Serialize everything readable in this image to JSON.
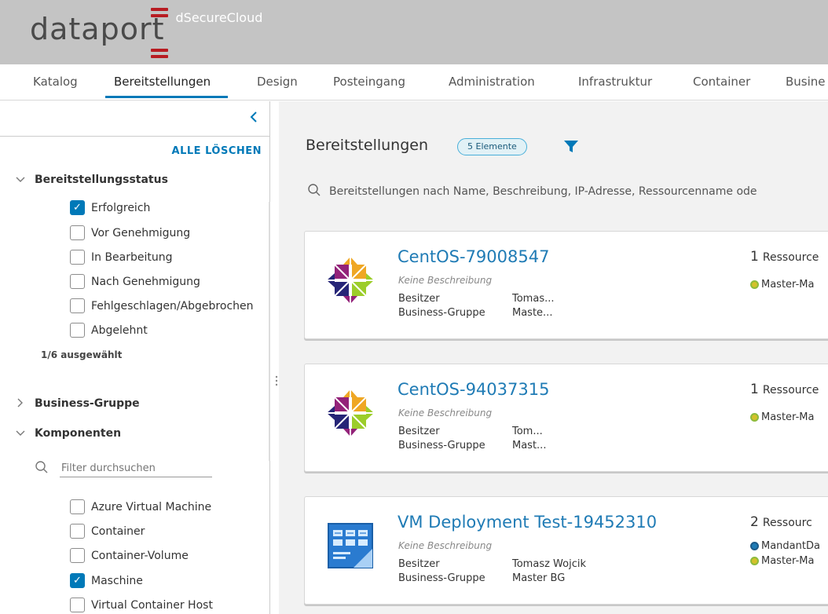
{
  "header": {
    "logo_text": "dataport",
    "product": "dSecureCloud"
  },
  "nav": {
    "items": [
      "Katalog",
      "Bereitstellungen",
      "Design",
      "Posteingang",
      "Administration",
      "Infrastruktur",
      "Container",
      "Busine"
    ],
    "active": "Bereitstellungen"
  },
  "sidebar": {
    "clear_all": "ALLE LÖSCHEN",
    "status_section": {
      "title": "Bereitstellungsstatus",
      "options": [
        {
          "label": "Erfolgreich",
          "checked": true
        },
        {
          "label": "Vor Genehmigung",
          "checked": false
        },
        {
          "label": "In Bearbeitung",
          "checked": false
        },
        {
          "label": "Nach Genehmigung",
          "checked": false
        },
        {
          "label": "Fehlgeschlagen/Abgebrochen",
          "checked": false
        },
        {
          "label": "Abgelehnt",
          "checked": false
        }
      ],
      "selected_count": "1/6 ausgewählt"
    },
    "business_group_section": {
      "title": "Business-Gruppe"
    },
    "components_section": {
      "title": "Komponenten",
      "search_placeholder": "Filter durchsuchen",
      "options": [
        {
          "label": "Azure Virtual Machine",
          "checked": false
        },
        {
          "label": "Container",
          "checked": false
        },
        {
          "label": "Container-Volume",
          "checked": false
        },
        {
          "label": "Maschine",
          "checked": true
        },
        {
          "label": "Virtual Container Host",
          "checked": false
        }
      ]
    }
  },
  "main": {
    "title": "Bereitstellungen",
    "count_badge": "5 Elemente",
    "search_placeholder": "Bereitstellungen nach Name, Beschreibung, IP-Adresse, Ressourcenname ode",
    "cards": [
      {
        "title": "CentOS-79008547",
        "description": "Keine Beschreibung",
        "owner_label": "Besitzer",
        "owner": "Tomas...",
        "group_label": "Business-Gruppe",
        "group": "Maste...",
        "resource_count": "1",
        "resource_word": "Ressource",
        "tags": [
          "Master-Ma"
        ],
        "icon": "centos-logo-icon"
      },
      {
        "title": "CentOS-94037315",
        "description": "Keine Beschreibung",
        "owner_label": "Besitzer",
        "owner": "Tom...",
        "group_label": "Business-Gruppe",
        "group": "Mast...",
        "resource_count": "1",
        "resource_word": "Ressource",
        "tags": [
          "Master-Ma"
        ],
        "icon": "centos-logo-icon"
      },
      {
        "title": "VM Deployment Test-19452310",
        "description": "Keine Beschreibung",
        "owner_label": "Besitzer",
        "owner": "Tomasz Wojcik",
        "group_label": "Business-Gruppe",
        "group": "Master BG",
        "resource_count": "2",
        "resource_word": "Ressourc",
        "tags": [
          "MandantDa",
          "Master-Ma"
        ],
        "icon": "blueprint-icon"
      }
    ]
  },
  "colors": {
    "accent": "#0079b8",
    "header_bg": "#c4c4c4",
    "logo_red": "#b81c22"
  }
}
